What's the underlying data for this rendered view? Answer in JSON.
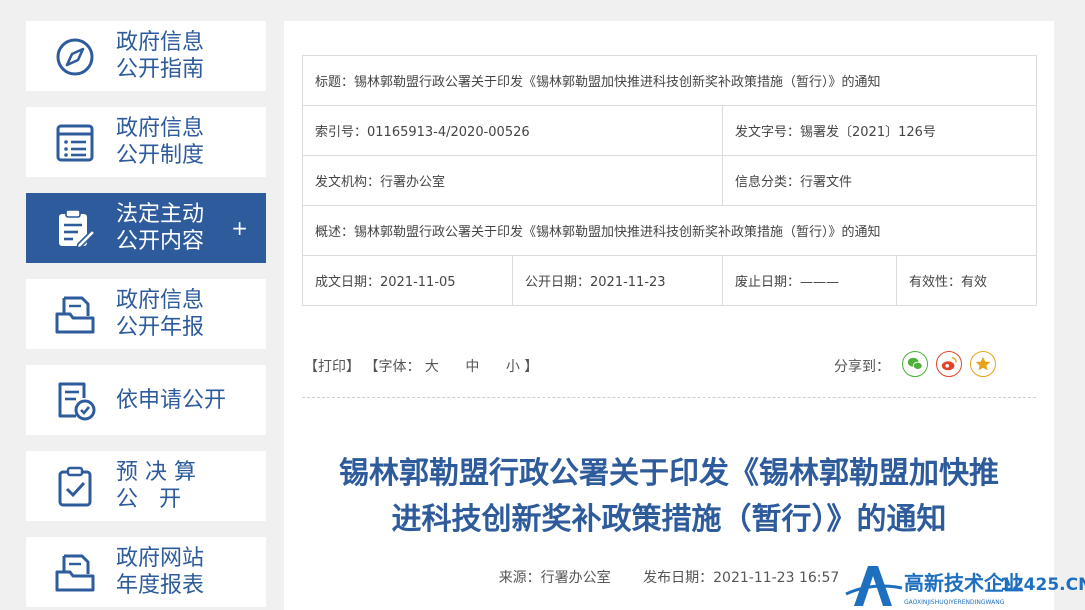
{
  "sidebar": {
    "items": [
      {
        "line1": "政府信息",
        "line2": "公开指南",
        "icon": "compass-icon",
        "active": false
      },
      {
        "line1": "政府信息",
        "line2": "公开制度",
        "icon": "list-document-icon",
        "active": false
      },
      {
        "line1": "法定主动",
        "line2": "公开内容",
        "icon": "clipboard-edit-icon",
        "active": true,
        "expand": "+"
      },
      {
        "line1": "政府信息",
        "line2": "公开年报",
        "icon": "folder-document-icon",
        "active": false
      },
      {
        "line1": "依申请公开",
        "line2": "",
        "icon": "document-check-icon",
        "active": false
      },
      {
        "line1": "预 决 算",
        "line2": "公   开",
        "icon": "clipboard-check-icon",
        "active": false
      },
      {
        "line1": "政府网站",
        "line2": "年度报表",
        "icon": "folder-report-icon",
        "active": false
      }
    ]
  },
  "meta": {
    "title": "标题：锡林郭勒盟行政公署关于印发《锡林郭勒盟加快推进科技创新奖补政策措施（暂行）》的通知",
    "index_no": "索引号：01165913-4/2020-00526",
    "doc_no": "发文字号：锡署发〔2021〕126号",
    "issuer": "发文机构：行署办公室",
    "category": "信息分类：行署文件",
    "summary": "概述：锡林郭勒盟行政公署关于印发《锡林郭勒盟加快推进科技创新奖补政策措施（暂行）》的通知",
    "created": "成文日期：2021-11-05",
    "published": "公开日期：2021-11-23",
    "abolished": "废止日期：———",
    "validity": "有效性：有效"
  },
  "toolbar": {
    "print": "【打印】",
    "font_label": "【字体：",
    "font_large": "大",
    "font_medium": "中",
    "font_small": "小",
    "font_close": "】",
    "share_label": "分享到："
  },
  "article": {
    "title_line1": "锡林郭勒盟行政公署关于印发《锡林郭勒盟加快推",
    "title_line2": "进科技创新奖补政策措施（暂行）》的通知",
    "source": "来源：行署办公室",
    "date": "发布日期：2021-11-23 16:57"
  },
  "watermark": {
    "text": "高新技术企业",
    "domain": "12425.CN",
    "pinyin": "GAOXINJISHUQIYERENDINGWANG"
  },
  "colors": {
    "brand": "#2d5b9c",
    "wechat": "#4fb03a",
    "weibo": "#e0452a",
    "favorite": "#e9a21a"
  }
}
